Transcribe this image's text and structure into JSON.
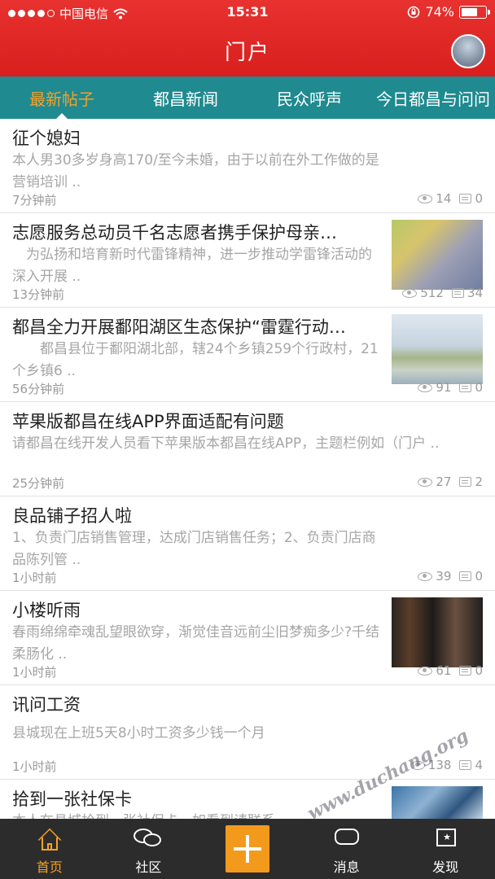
{
  "status_bar": {
    "carrier": "中国电信",
    "time": "15:31",
    "battery": "74%",
    "battery_level": 0.74
  },
  "header": {
    "title": "门户"
  },
  "tabs": [
    {
      "label": "最新帖子",
      "active": true
    },
    {
      "label": "都昌新闻",
      "active": false
    },
    {
      "label": "民众呼声",
      "active": false
    },
    {
      "label": "今日都昌与问问",
      "active": false
    }
  ],
  "posts": [
    {
      "title": "征个媳妇",
      "summary": "本人男30多岁身高170/至今未婚，由于以前在外工作做的是营销培训 ..",
      "time": "7分钟前",
      "views": "14",
      "comments": "0"
    },
    {
      "title": "志愿服务总动员千名志愿者携手保护母亲…",
      "summary": "　为弘扬和培育新时代雷锋精神，进一步推动学雷锋活动的深入开展 ..",
      "time": "13分钟前",
      "views": "512",
      "comments": "34"
    },
    {
      "title": "都昌全力开展鄱阳湖区生态保护“雷霆行动…",
      "summary": "　　都昌县位于鄱阳湖北部，辖24个乡镇259个行政村，21个乡镇6 ..",
      "time": "56分钟前",
      "views": "91",
      "comments": "0"
    },
    {
      "title": "苹果版都昌在线APP界面适配有问题",
      "summary": "请都昌在线开发人员看下苹果版本都昌在线APP，主题栏例如（门户 ..",
      "time": "25分钟前",
      "views": "27",
      "comments": "2"
    },
    {
      "title": "良品铺子招人啦",
      "summary": "1、负责门店销售管理，达成门店销售任务；2、负责门店商品陈列管 ..",
      "time": "1小时前",
      "views": "39",
      "comments": "0"
    },
    {
      "title": "小楼听雨",
      "summary": "春雨绵绵牵魂乱望眼欲穿，渐觉佳音远前尘旧梦痴多少?千结柔肠化 ..",
      "time": "1小时前",
      "views": "61",
      "comments": "0"
    },
    {
      "title": "讯问工资",
      "summary": "县城现在上班5天8小时工资多少钱一个月",
      "time": "1小时前",
      "views": "138",
      "comments": "4"
    },
    {
      "title": "拾到一张社保卡",
      "summary": "本人在县城拾到一张社保卡，如看到请联系"
    }
  ],
  "bottom_nav": [
    {
      "label": "首页",
      "icon": "home-icon",
      "active": true
    },
    {
      "label": "社区",
      "icon": "chat-bubble-icon",
      "active": false
    },
    {
      "label": "",
      "icon": "plus-icon",
      "active": false
    },
    {
      "label": "消息",
      "icon": "message-icon",
      "active": false
    },
    {
      "label": "发现",
      "icon": "discover-flag-icon",
      "active": false
    }
  ],
  "watermark": "www.duchang.org",
  "colors": {
    "header_red": "#e12a27",
    "tab_teal": "#1f8a8f",
    "active_orange": "#f39a1d",
    "nav_dark": "#2c2c2c"
  }
}
